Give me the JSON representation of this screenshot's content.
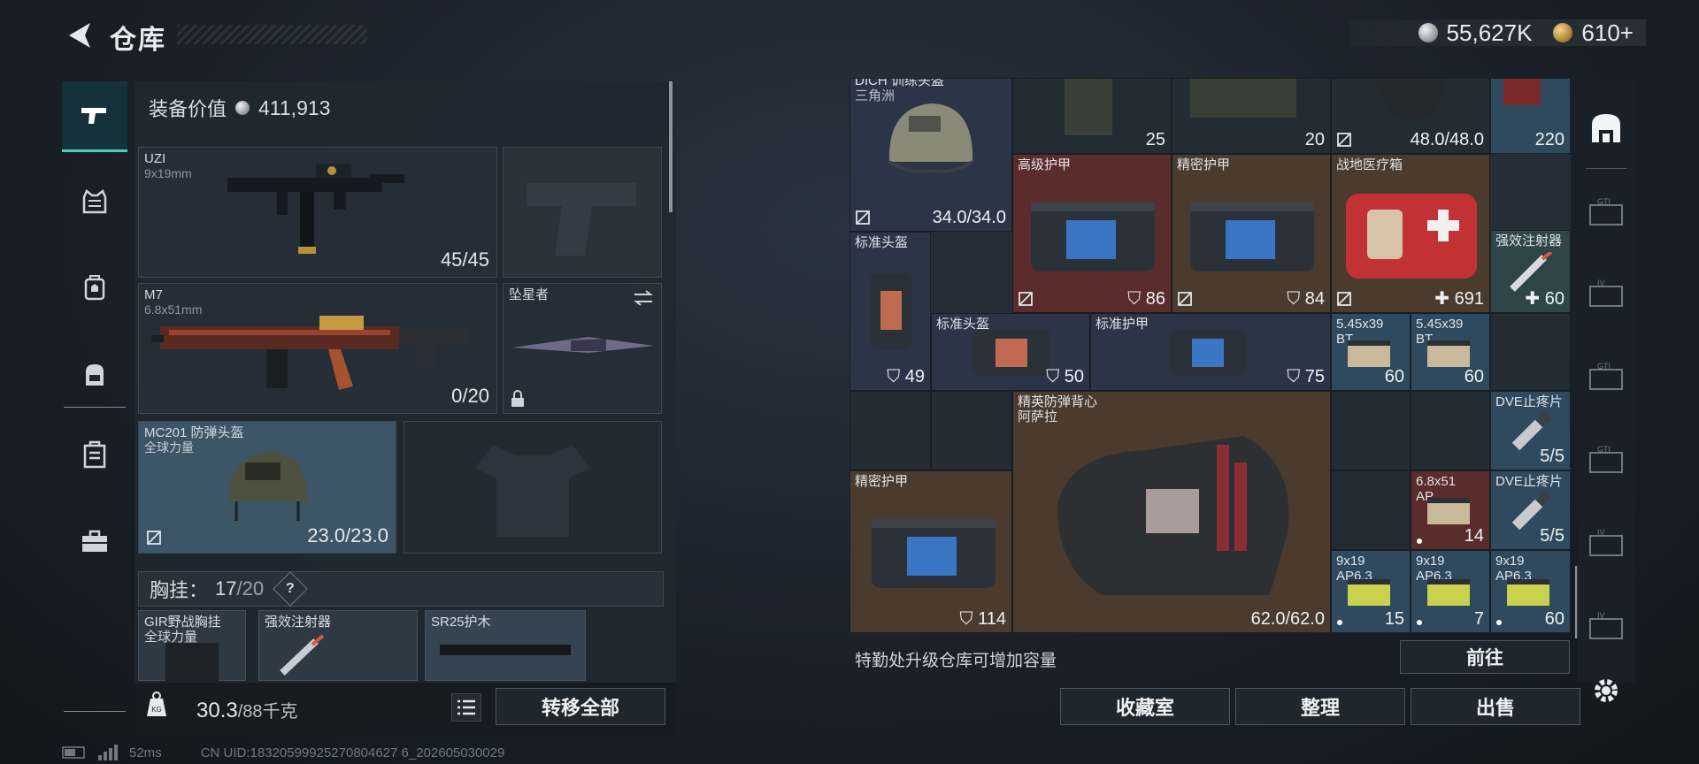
{
  "header": {
    "title": "仓库",
    "currency_silver": "55,627K",
    "currency_gold": "610+"
  },
  "categories": [
    {
      "name": "weapon",
      "active": true
    },
    {
      "name": "armor",
      "active": false
    },
    {
      "name": "chest-rig",
      "active": false
    },
    {
      "name": "backpack",
      "active": false
    },
    {
      "name": "container",
      "active": false
    },
    {
      "name": "toolbox",
      "active": false
    }
  ],
  "equipment": {
    "value_label": "装备价值",
    "value": "411,913",
    "primary": {
      "name": "UZI",
      "caliber": "9x19mm",
      "ammo": "45/45"
    },
    "secondary": {
      "name": "M7",
      "caliber": "6.8x51mm",
      "ammo": "0/20"
    },
    "melee": {
      "name": "坠星者"
    },
    "helmet": {
      "name": "MC201 防弹头盔",
      "origin": "全球力量",
      "durability": "23.0/23.0"
    },
    "chest_label": "胸挂：",
    "chest_used": "17",
    "chest_total": "/20",
    "help": "?",
    "chest_items": [
      {
        "name": "GIR野战胸挂",
        "sub": "全球力量"
      },
      {
        "name": "强效注射器",
        "sub": ""
      },
      {
        "name": "SR25护木",
        "sub": ""
      }
    ],
    "weight": "30.3",
    "weight_max": "/88千克",
    "transfer_all": "转移全部"
  },
  "storage": {
    "items": [
      {
        "label": "DICH 训练头盔",
        "sub": "三角洲",
        "count": "34.0/34.0"
      },
      {
        "label": "",
        "count": "25"
      },
      {
        "label": "",
        "count": "20"
      },
      {
        "label": "",
        "count": "48.0/48.0"
      },
      {
        "label": "",
        "count": "220"
      },
      {
        "label": "高级护甲",
        "count": "86"
      },
      {
        "label": "精密护甲",
        "count": "84"
      },
      {
        "label": "战地医疗箱",
        "count": "691"
      },
      {
        "label": "强效注射器",
        "count": "60"
      },
      {
        "label": "标准头盔",
        "count": "49"
      },
      {
        "label": "标准头盔",
        "count": "50"
      },
      {
        "label": "标准护甲",
        "count": "75"
      },
      {
        "label": "5.45x39",
        "sub": "BT",
        "count": "60"
      },
      {
        "label": "5.45x39",
        "sub": "BT",
        "count": "60"
      },
      {
        "label": "精英防弹背心",
        "sub": "阿萨拉",
        "count": "62.0/62.0"
      },
      {
        "label": "DVE止疼片",
        "count": "5/5"
      },
      {
        "label": "精密护甲",
        "count": "114"
      },
      {
        "label": "6.8x51",
        "sub": "AP",
        "count": "14"
      },
      {
        "label": "DVE止疼片",
        "count": "5/5"
      },
      {
        "label": "9x19",
        "sub": "AP6.3",
        "count": "15"
      },
      {
        "label": "9x19",
        "sub": "AP6.3",
        "count": "7"
      },
      {
        "label": "9x19",
        "sub": "AP6.3",
        "count": "60"
      }
    ],
    "upgrade_info": "特勤处升级仓库可增加容量",
    "goto": "前往",
    "collection": "收藏室",
    "organize": "整理",
    "sell": "出售"
  },
  "side_tabs": [
    "GTI",
    "IV",
    "GTI",
    "GTI",
    "IV",
    "IV"
  ],
  "status": {
    "ping": "52ms",
    "uid": "CN UID:18320599925270804627 6_202605030029"
  }
}
